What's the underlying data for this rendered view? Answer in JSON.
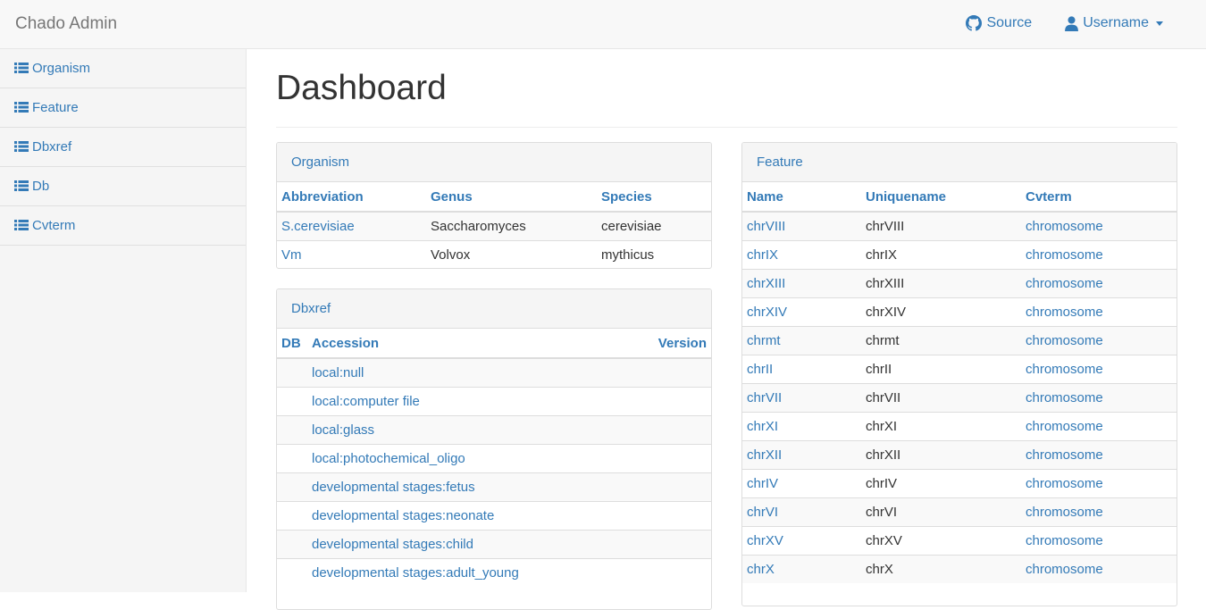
{
  "navbar": {
    "brand": "Chado Admin",
    "source_label": "Source",
    "user_label": "Username",
    "icons": {
      "source": "github-icon",
      "user": "user-icon"
    }
  },
  "sidebar": {
    "items": [
      {
        "label": "Organism",
        "icon": "list-icon"
      },
      {
        "label": "Feature",
        "icon": "list-icon"
      },
      {
        "label": "Dbxref",
        "icon": "list-icon"
      },
      {
        "label": "Db",
        "icon": "list-icon"
      },
      {
        "label": "Cvterm",
        "icon": "list-icon"
      }
    ]
  },
  "main": {
    "title": "Dashboard",
    "organism": {
      "heading": "Organism",
      "columns": [
        "Abbreviation",
        "Genus",
        "Species"
      ],
      "rows": [
        [
          "S.cerevisiae",
          "Saccharomyces",
          "cerevisiae"
        ],
        [
          "Vm",
          "Volvox",
          "mythicus"
        ]
      ]
    },
    "dbxref": {
      "heading": "Dbxref",
      "columns": [
        "DB",
        "Accession",
        "Version"
      ],
      "rows": [
        [
          "",
          "local:null",
          ""
        ],
        [
          "",
          "local:computer file",
          ""
        ],
        [
          "",
          "local:glass",
          ""
        ],
        [
          "",
          "local:photochemical_oligo",
          ""
        ],
        [
          "",
          "developmental stages:fetus",
          ""
        ],
        [
          "",
          "developmental stages:neonate",
          ""
        ],
        [
          "",
          "developmental stages:child",
          ""
        ],
        [
          "",
          "developmental stages:adult_young",
          ""
        ]
      ]
    },
    "feature": {
      "heading": "Feature",
      "columns": [
        "Name",
        "Uniquename",
        "Cvterm"
      ],
      "rows": [
        [
          "chrVIII",
          "chrVIII",
          "chromosome"
        ],
        [
          "chrIX",
          "chrIX",
          "chromosome"
        ],
        [
          "chrXIII",
          "chrXIII",
          "chromosome"
        ],
        [
          "chrXIV",
          "chrXIV",
          "chromosome"
        ],
        [
          "chrmt",
          "chrmt",
          "chromosome"
        ],
        [
          "chrII",
          "chrII",
          "chromosome"
        ],
        [
          "chrVII",
          "chrVII",
          "chromosome"
        ],
        [
          "chrXI",
          "chrXI",
          "chromosome"
        ],
        [
          "chrXII",
          "chrXII",
          "chromosome"
        ],
        [
          "chrIV",
          "chrIV",
          "chromosome"
        ],
        [
          "chrVI",
          "chrVI",
          "chromosome"
        ],
        [
          "chrXV",
          "chrXV",
          "chromosome"
        ],
        [
          "chrX",
          "chrX",
          "chromosome"
        ]
      ]
    }
  },
  "colors": {
    "link": "#337ab7",
    "navbar_bg": "#f8f8f8",
    "sidebar_bg": "#f5f5f5",
    "stripe": "#f9f9f9"
  }
}
